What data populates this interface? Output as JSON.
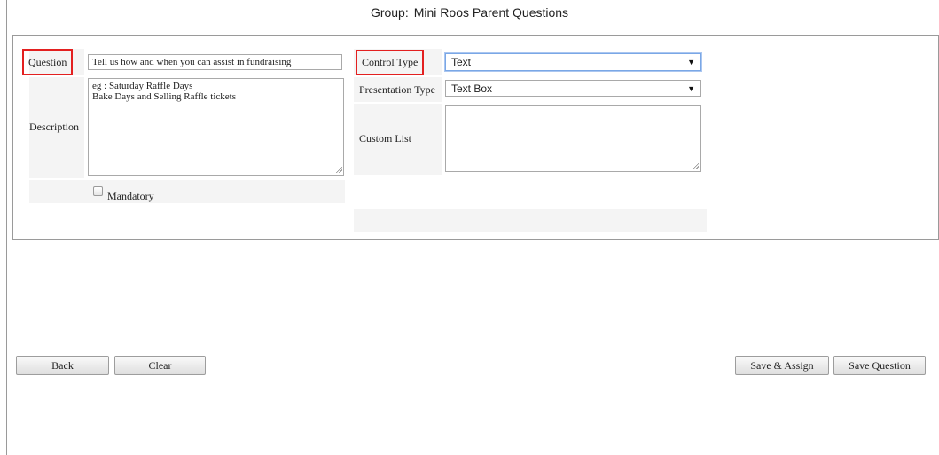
{
  "header": {
    "group_prefix": "Group:",
    "group_name": "Mini Roos Parent Questions"
  },
  "form": {
    "question": {
      "label": "Question",
      "value": "Tell us how and when you can assist in fundraising"
    },
    "description": {
      "label": "Description",
      "value": "eg : Saturday Raffle Days\nBake Days and Selling Raffle tickets"
    },
    "mandatory": {
      "label": "Mandatory",
      "checked": false
    },
    "control_type": {
      "label": "Control Type",
      "selected": "Text"
    },
    "presentation_type": {
      "label": "Presentation Type",
      "selected": "Text Box"
    },
    "custom_list": {
      "label": "Custom List",
      "value": ""
    }
  },
  "actions": {
    "back": "Back",
    "clear": "Clear",
    "save_assign": "Save & Assign",
    "save_question": "Save Question"
  },
  "icons": {
    "dropdown": "triangle-down-icon"
  },
  "colors": {
    "highlight": "#e32020",
    "focus": "#7aa7e6"
  }
}
